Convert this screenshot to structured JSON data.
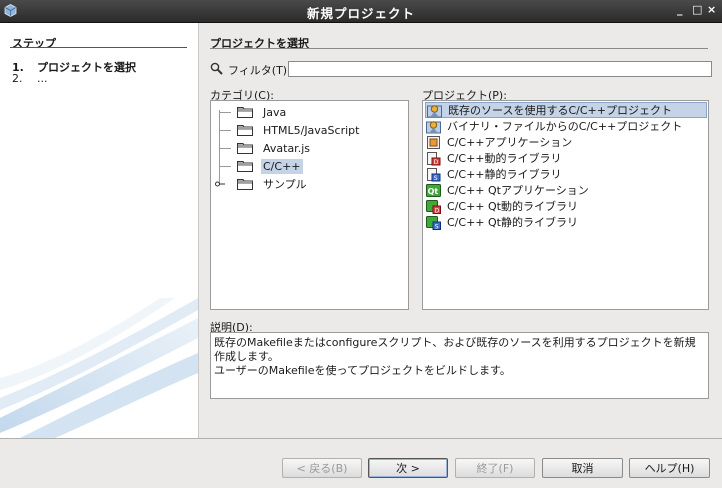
{
  "window": {
    "title": "新規プロジェクト",
    "controls": [
      "_",
      "□",
      "×"
    ]
  },
  "sidebar": {
    "header": "ステップ",
    "steps": [
      {
        "num": "1.",
        "label": "プロジェクトを選択",
        "active": true
      },
      {
        "num": "2.",
        "label": "...",
        "active": false
      }
    ]
  },
  "main": {
    "section_title": "プロジェクトを選択",
    "filter": {
      "label": "フィルタ(T):",
      "value": ""
    },
    "categories": {
      "label": "カテゴリ(C):",
      "items": [
        {
          "label": "Java",
          "selected": false
        },
        {
          "label": "HTML5/JavaScript",
          "selected": false
        },
        {
          "label": "Avatar.js",
          "selected": false
        },
        {
          "label": "C/C++",
          "selected": true
        },
        {
          "label": "サンプル",
          "selected": false,
          "expandable": true
        }
      ]
    },
    "projects": {
      "label": "プロジェクト(P):",
      "items": [
        {
          "label": "既存のソースを使用するC/C++プロジェクト",
          "selected": true,
          "icon": "source-project-icon"
        },
        {
          "label": "バイナリ・ファイルからのC/C++プロジェクト",
          "selected": false,
          "icon": "binary-project-icon"
        },
        {
          "label": "C/C++アプリケーション",
          "selected": false,
          "icon": "app-icon"
        },
        {
          "label": "C/C++動的ライブラリ",
          "selected": false,
          "icon": "dynamic-lib-icon"
        },
        {
          "label": "C/C++静的ライブラリ",
          "selected": false,
          "icon": "static-lib-icon"
        },
        {
          "label": "C/C++ Qtアプリケーション",
          "selected": false,
          "icon": "qt-app-icon"
        },
        {
          "label": "C/C++ Qt動的ライブラリ",
          "selected": false,
          "icon": "qt-dynamic-lib-icon"
        },
        {
          "label": "C/C++ Qt静的ライブラリ",
          "selected": false,
          "icon": "qt-static-lib-icon"
        }
      ]
    },
    "description": {
      "label": "説明(D):",
      "lines": [
        "既存のMakefileまたはconfigureスクリプト、および既存のソースを利用するプロジェクトを新規作成します。",
        "ユーザーのMakefileを使ってプロジェクトをビルドします。"
      ]
    }
  },
  "buttons": {
    "back": "< 戻る(B)",
    "next": "次 >",
    "finish": "終了(F)",
    "cancel": "取消",
    "help": "ヘルプ(H)"
  },
  "colors": {
    "selection": "#c5d3e6",
    "titlebar": "#2b2b2b",
    "qt_green": "#41a83a"
  }
}
